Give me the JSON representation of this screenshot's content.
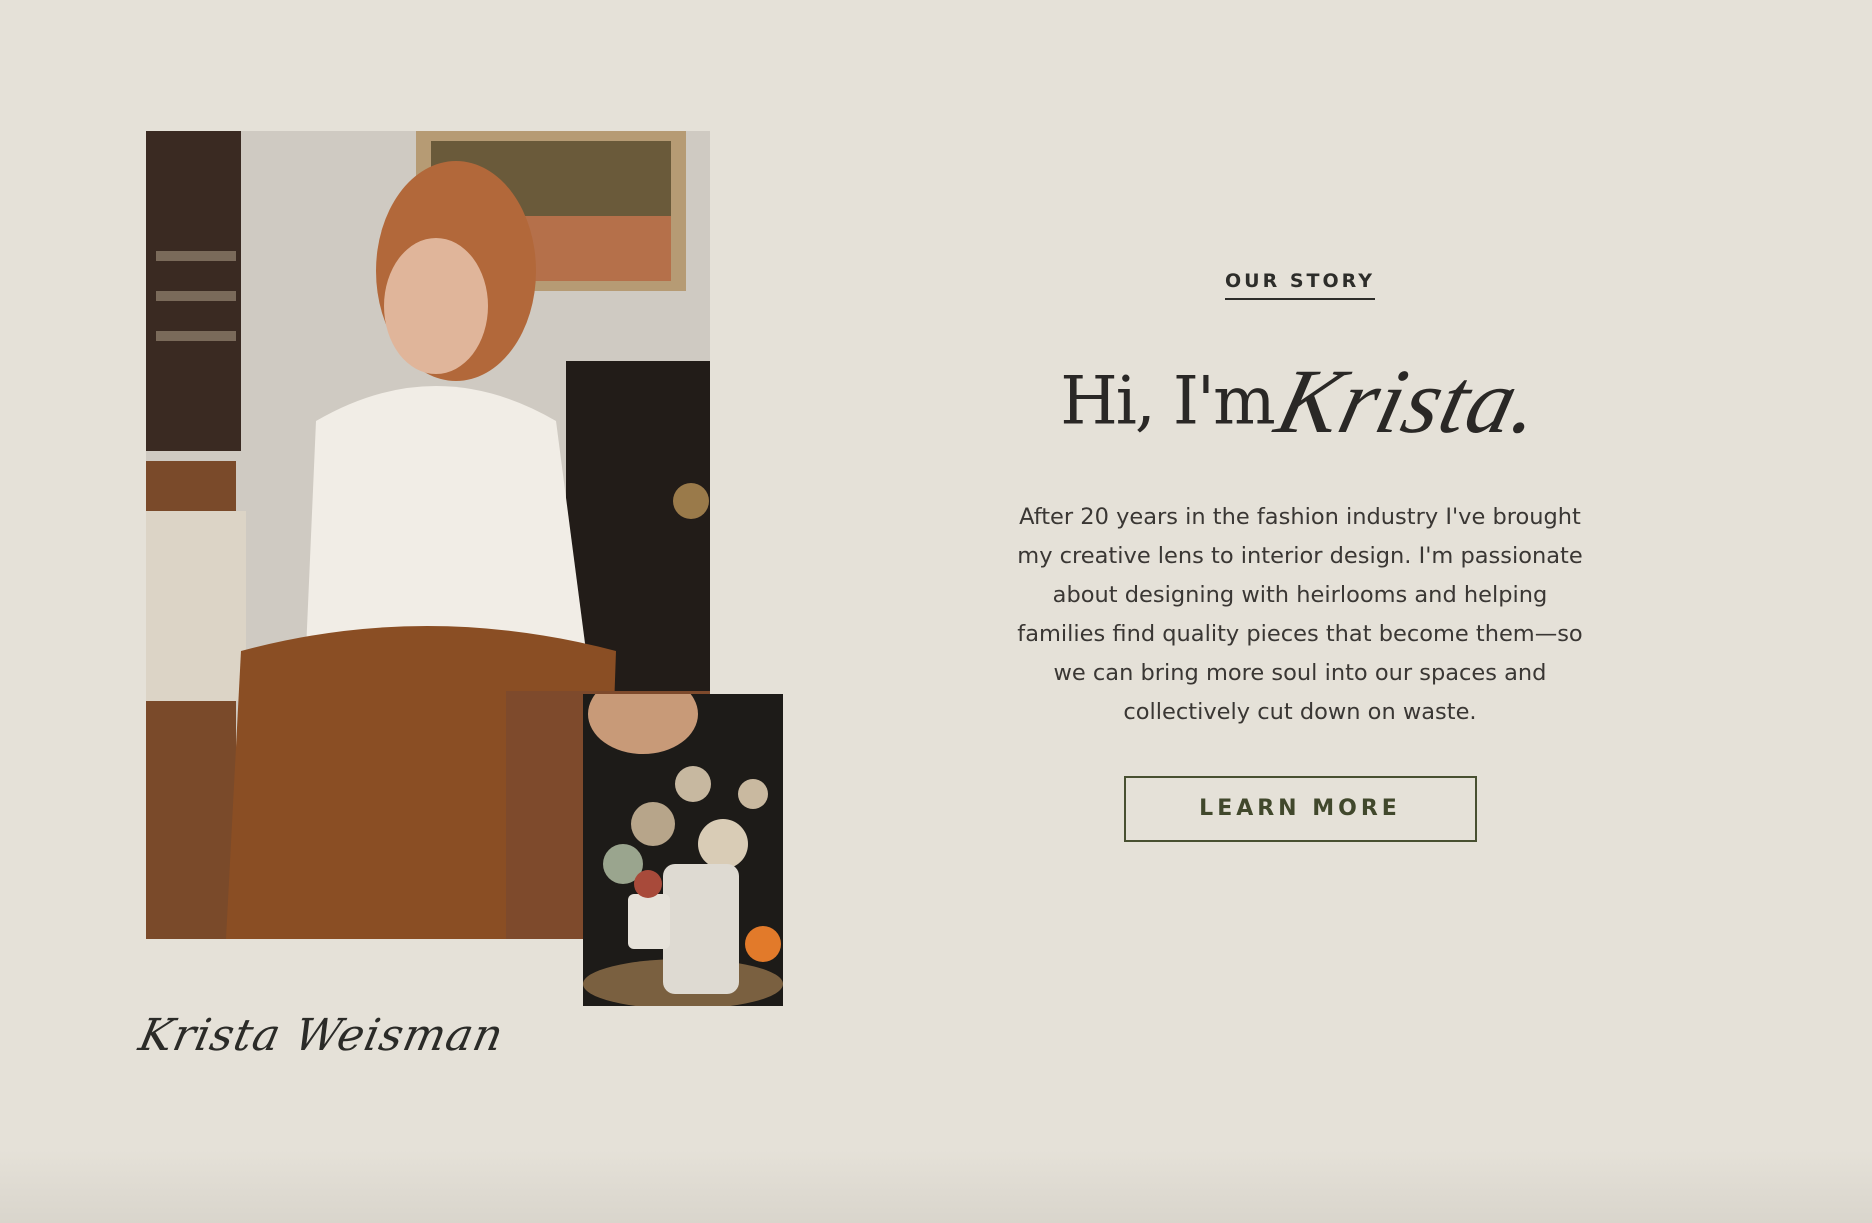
{
  "section": {
    "eyebrow": "OUR STORY",
    "headline_plain": "Hi, I'm",
    "headline_script": "Krista.",
    "body": "After 20 years in the fashion industry I've brought my creative lens to interior design. I'm passionate about designing with heirlooms and helping families find quality pieces that become them—so we can bring more soul into our spaces and collectively cut down on waste.",
    "cta_label": "LEARN MORE"
  },
  "signature": "Krista Weisman",
  "colors": {
    "background": "#e5e1d8",
    "text": "#2d2d2a",
    "accent": "#485031"
  }
}
